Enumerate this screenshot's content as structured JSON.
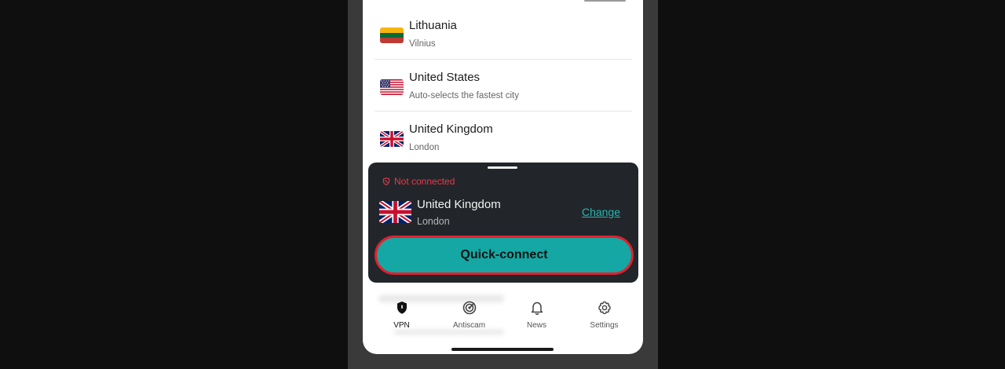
{
  "countries": [
    {
      "name": "Lithuania",
      "subtitle": "Vilnius",
      "flag_icon": "lithuania-flag-icon"
    },
    {
      "name": "United States",
      "subtitle": "Auto-selects the fastest city",
      "flag_icon": "usa-flag-icon"
    },
    {
      "name": "United Kingdom",
      "subtitle": "London",
      "flag_icon": "uk-flag-icon"
    }
  ],
  "panel": {
    "status": "Not connected",
    "status_color": "#e8394d",
    "country": "United Kingdom",
    "city": "London",
    "change_label": "Change",
    "quick_connect_label": "Quick-connect",
    "accent": "#15a7a3",
    "highlight_border": "#e3202e"
  },
  "nav": {
    "items": [
      {
        "label": "VPN",
        "icon": "shield-icon",
        "active": true
      },
      {
        "label": "Antiscam",
        "icon": "radar-icon",
        "active": false
      },
      {
        "label": "News",
        "icon": "bell-icon",
        "active": false
      },
      {
        "label": "Settings",
        "icon": "gear-icon",
        "active": false
      }
    ]
  }
}
